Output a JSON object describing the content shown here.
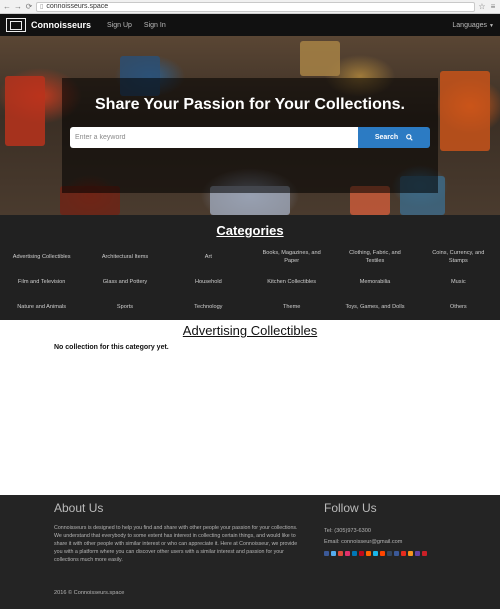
{
  "browser": {
    "url": "connoisseurs.space"
  },
  "navbar": {
    "brand": "Connoisseurs",
    "links": [
      "Sign Up",
      "Sign In"
    ],
    "languages": "Languages"
  },
  "hero": {
    "title": "Share Your Passion for Your Collections.",
    "search_placeholder": "Enter a keyword",
    "search_button": "Search"
  },
  "categories": {
    "title": "Categories",
    "items": [
      "Advertising Collectibles",
      "Architectural Items",
      "Art",
      "Books, Magazines, and Paper",
      "Clothing, Fabric, and Textiles",
      "Coins, Currency, and Stamps",
      "Film and Television",
      "Glass and Pottery",
      "Household",
      "Kitchen Collectibles",
      "Memorabilia",
      "Music",
      "Nature and Animals",
      "Sports",
      "Technology",
      "Theme",
      "Toys, Games, and Dolls",
      "Others"
    ]
  },
  "main": {
    "title": "Advertising Collectibles",
    "empty_message": "No collection for this category yet."
  },
  "footer": {
    "about_title": "About Us",
    "about_text": "Connoisseurs is designed to help you find and share with other people your passion for your collections. We understand that everybody to some extent has interest in collecting certain things, and would like to share it with other people with similar interest or who can appreciate it. Here at Connoisseur, we provide you with a platform where you can discover other users with a similar interest and passion for your collections much more easily.",
    "follow_title": "Follow Us",
    "tel": "Tel: (305)973-6300",
    "email": "Email: connoisseur@gmail.com",
    "social_colors": [
      "#3b5998",
      "#55acee",
      "#dd4b39",
      "#e1306c",
      "#0077b5",
      "#bd081c",
      "#ff6600",
      "#1ab7ea",
      "#ff4500",
      "#35465c",
      "#3b5998",
      "#e62b1e",
      "#f7931e",
      "#6441a5",
      "#cb2027"
    ],
    "copyright": "2016 © Connoisseurs.space"
  }
}
